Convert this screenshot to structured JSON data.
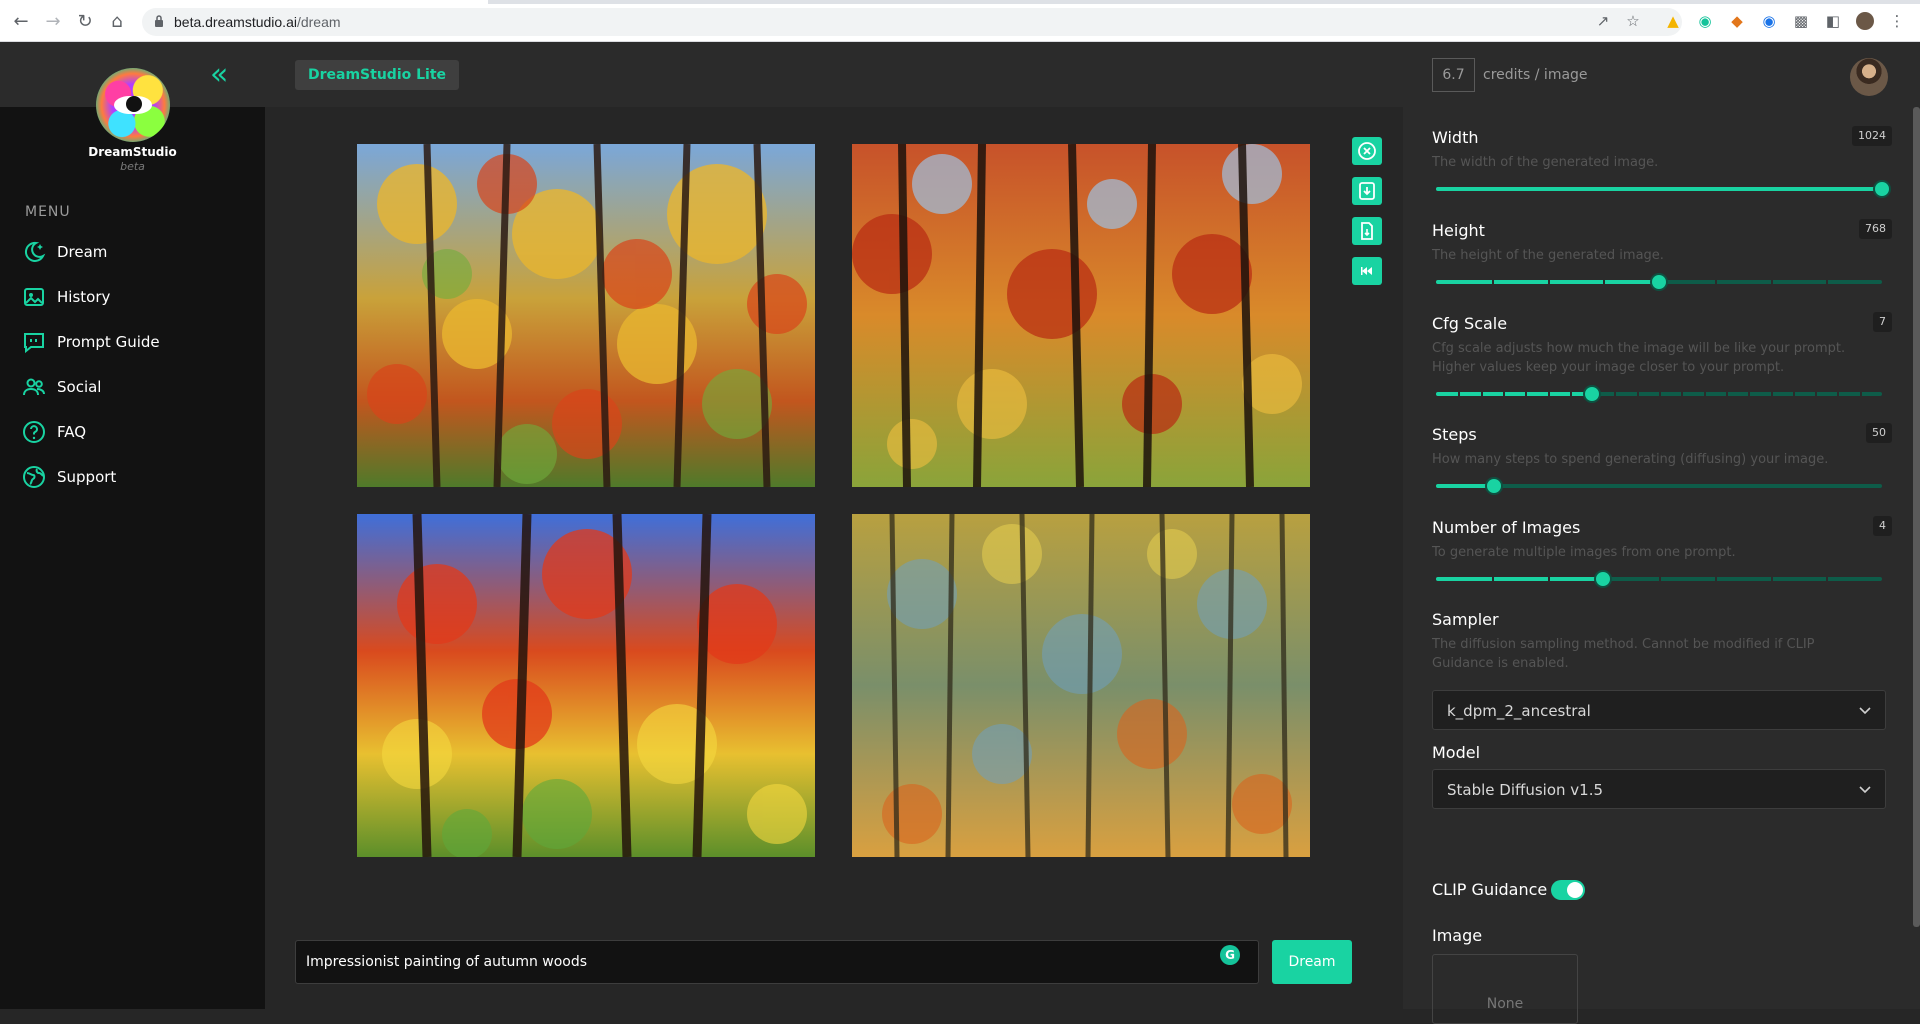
{
  "browser": {
    "url_host": "beta.dreamstudio.ai",
    "url_path": "/dream"
  },
  "sidebar": {
    "brand": "DreamStudio",
    "brand_sub": "beta",
    "menu_title": "MENU",
    "items": [
      {
        "label": "Dream",
        "icon": "moon-star-icon"
      },
      {
        "label": "History",
        "icon": "image-gallery-icon"
      },
      {
        "label": "Prompt Guide",
        "icon": "chat-quote-icon"
      },
      {
        "label": "Social",
        "icon": "users-icon"
      },
      {
        "label": "FAQ",
        "icon": "question-icon"
      },
      {
        "label": "Support",
        "icon": "globe-icon"
      }
    ]
  },
  "header": {
    "app_badge": "DreamStudio Lite",
    "credits_value": "6.7",
    "credits_label": "credits / image"
  },
  "images": [
    {
      "alt": "autumn woods 1"
    },
    {
      "alt": "autumn woods 2"
    },
    {
      "alt": "autumn woods 3"
    },
    {
      "alt": "autumn woods 4"
    }
  ],
  "tools": [
    "close-circle-icon",
    "download-icon",
    "file-download-icon",
    "rewind-icon"
  ],
  "prompt": {
    "value": "Impressionist painting of autumn woods",
    "button": "Dream"
  },
  "controls": {
    "width": {
      "label": "Width",
      "value": "1024",
      "desc": "The width of the generated image.",
      "fraction": 1.0
    },
    "height": {
      "label": "Height",
      "value": "768",
      "desc": "The height of the generated image.",
      "fraction": 0.5
    },
    "cfg": {
      "label": "Cfg Scale",
      "value": "7",
      "desc": "Cfg scale adjusts how much the image will be like your prompt. Higher values keep your image closer to your prompt.",
      "fraction": 0.35
    },
    "steps": {
      "label": "Steps",
      "value": "50",
      "desc": "How many steps to spend generating (diffusing) your image.",
      "fraction": 0.13
    },
    "num_images": {
      "label": "Number of Images",
      "value": "4",
      "desc": "To generate multiple images from one prompt.",
      "fraction": 0.375
    },
    "sampler": {
      "label": "Sampler",
      "desc": "The diffusion sampling method. Cannot be modified if CLIP Guidance is enabled.",
      "value": "k_dpm_2_ancestral"
    },
    "model": {
      "label": "Model",
      "value": "Stable Diffusion v1.5"
    },
    "clip": {
      "label": "CLIP Guidance",
      "enabled": true
    },
    "image": {
      "label": "Image",
      "value": "None"
    }
  },
  "colors": {
    "accent": "#19d3a2",
    "sidebar_bg": "#121212",
    "main_bg": "#262626",
    "panel_bg": "#2b2b2b"
  }
}
